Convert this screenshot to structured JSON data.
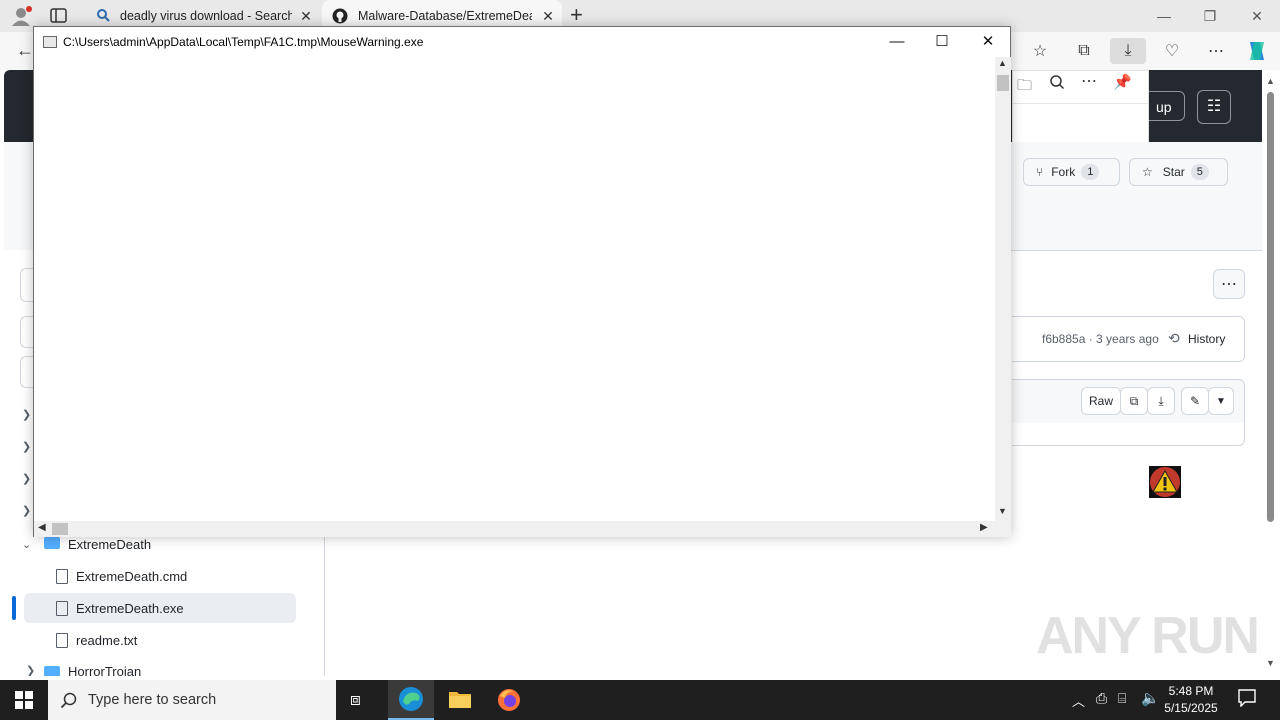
{
  "browser": {
    "tabs": [
      {
        "label": "deadly virus download - Search"
      },
      {
        "label": "Malware-Database/ExtremeDeath"
      }
    ],
    "new_tab": "+"
  },
  "github": {
    "signup_label": "up",
    "fork": {
      "label": "Fork",
      "count": "1"
    },
    "star": {
      "label": "Star",
      "count": "5"
    },
    "commit": {
      "hash_time": "f6b885a · 3 years ago",
      "history_label": "History"
    },
    "file_actions": {
      "raw_label": "Raw"
    },
    "tree": [
      {
        "name": "ExtremeDeath",
        "type": "folder",
        "expanded": true
      },
      {
        "name": "ExtremeDeath.cmd",
        "type": "file"
      },
      {
        "name": "ExtremeDeath.exe",
        "type": "file",
        "selected": true
      },
      {
        "name": "readme.txt",
        "type": "file"
      },
      {
        "name": "HorrorTrojan",
        "type": "folder",
        "expanded": false
      }
    ]
  },
  "popup": {
    "title_path": "C:\\Users\\admin\\AppData\\Local\\Temp\\FA1C.tmp\\MouseWarning.exe"
  },
  "taskbar": {
    "search_placeholder": "Type here to search",
    "time": "5:48 PM",
    "date": "5/15/2025"
  },
  "watermark": "ANY RUN",
  "colors": {
    "gh_header": "#24292f",
    "accent_selected": "#0969da",
    "taskbar": "#1f1f1f"
  }
}
